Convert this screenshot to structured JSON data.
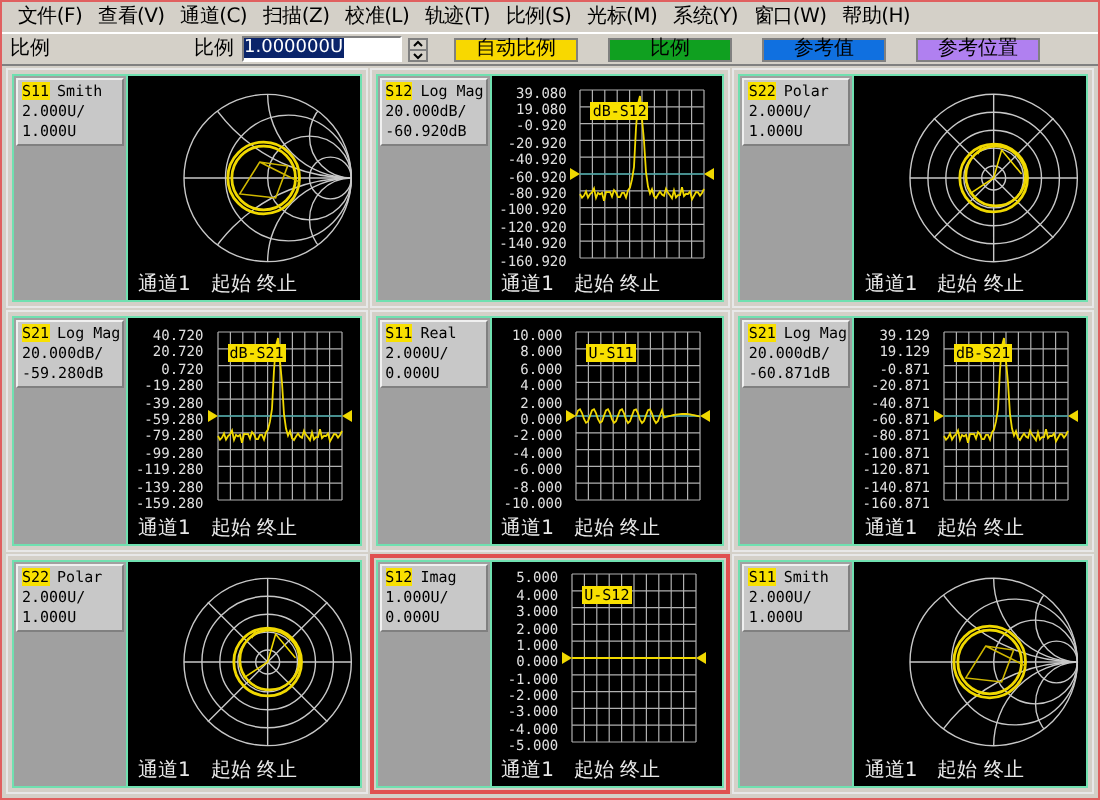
{
  "menu": [
    "文件(F)",
    "查看(V)",
    "通道(C)",
    "扫描(Z)",
    "校准(L)",
    "轨迹(T)",
    "比例(S)",
    "光标(M)",
    "系统(Y)",
    "窗口(W)",
    "帮助(H)"
  ],
  "toolbar": {
    "section_label": "比例",
    "field_label": "比例",
    "value": "1.000000U",
    "buttons": [
      {
        "label": "自动比例",
        "color": "#f8d800"
      },
      {
        "label": "比例",
        "color": "#10a020"
      },
      {
        "label": "参考值",
        "color": "#1070e0"
      },
      {
        "label": "参考位置",
        "color": "#b080f0"
      }
    ]
  },
  "panels": [
    {
      "param": "S11",
      "format": "Smith",
      "scale": "2.000U/",
      "reference": "1.000U",
      "kind": "smith",
      "selected": false,
      "channel": "通道1",
      "sweep": "起始 终止"
    },
    {
      "param": "S12",
      "format": "Log Mag",
      "scale": "20.000dB/",
      "reference": "-60.920dB",
      "kind": "logmag",
      "selected": false,
      "marker": "dB-S12",
      "yticks": [
        "39.080",
        "19.080",
        "-0.920",
        "-20.920",
        "-40.920",
        "-60.920",
        "-80.920",
        "-100.920",
        "-120.920",
        "-140.920",
        "-160.920"
      ],
      "channel": "通道1",
      "sweep": "起始 终止"
    },
    {
      "param": "S22",
      "format": "Polar",
      "scale": "2.000U/",
      "reference": "1.000U",
      "kind": "polar",
      "selected": false,
      "channel": "通道1",
      "sweep": "起始 终止"
    },
    {
      "param": "S21",
      "format": "Log Mag",
      "scale": "20.000dB/",
      "reference": "-59.280dB",
      "kind": "logmag",
      "selected": false,
      "marker": "dB-S21",
      "yticks": [
        "40.720",
        "20.720",
        "0.720",
        "-19.280",
        "-39.280",
        "-59.280",
        "-79.280",
        "-99.280",
        "-119.280",
        "-139.280",
        "-159.280"
      ],
      "channel": "通道1",
      "sweep": "起始 终止"
    },
    {
      "param": "S11",
      "format": "Real",
      "scale": "2.000U/",
      "reference": "0.000U",
      "kind": "real",
      "selected": false,
      "marker": "U-S11",
      "yticks": [
        "10.000",
        "8.000",
        "6.000",
        "4.000",
        "2.000",
        "0.000",
        "-2.000",
        "-4.000",
        "-6.000",
        "-8.000",
        "-10.000"
      ],
      "channel": "通道1",
      "sweep": "起始 终止"
    },
    {
      "param": "S21",
      "format": "Log Mag",
      "scale": "20.000dB/",
      "reference": "-60.871dB",
      "kind": "logmag",
      "selected": false,
      "marker": "dB-S21",
      "yticks": [
        "39.129",
        "19.129",
        "-0.871",
        "-20.871",
        "-40.871",
        "-60.871",
        "-80.871",
        "-100.871",
        "-120.871",
        "-140.871",
        "-160.871"
      ],
      "channel": "通道1",
      "sweep": "起始 终止"
    },
    {
      "param": "S22",
      "format": "Polar",
      "scale": "2.000U/",
      "reference": "1.000U",
      "kind": "polar",
      "selected": false,
      "channel": "通道1",
      "sweep": "起始 终止"
    },
    {
      "param": "S12",
      "format": "Imag",
      "scale": "1.000U/",
      "reference": "0.000U",
      "kind": "imag",
      "selected": true,
      "marker": "U-S12",
      "yticks": [
        "5.000",
        "4.000",
        "3.000",
        "2.000",
        "1.000",
        "0.000",
        "-1.000",
        "-2.000",
        "-3.000",
        "-4.000",
        "-5.000"
      ],
      "channel": "通道1",
      "sweep": "起始 终止"
    },
    {
      "param": "S11",
      "format": "Smith",
      "scale": "2.000U/",
      "reference": "1.000U",
      "kind": "smith",
      "selected": false,
      "channel": "通道1",
      "sweep": "起始 终止"
    }
  ]
}
